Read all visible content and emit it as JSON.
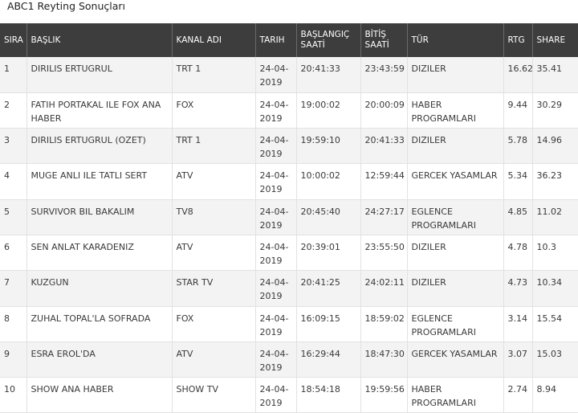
{
  "title": "ABC1 Reyting Sonuçları",
  "columns": [
    "SIRA",
    "BAŞLIK",
    "KANAL ADI",
    "TARIH",
    "BAŞLANGIÇ SAATİ",
    "BİTİŞ SAATİ",
    "TÜR",
    "RTG",
    "SHARE"
  ],
  "rows": [
    {
      "sira": "1",
      "baslik": "DIRILIS ERTUGRUL",
      "kanal": "TRT 1",
      "tarih": "24-04-2019",
      "baslangic": "20:41:33",
      "bitis": "23:43:59",
      "tur": "DIZILER",
      "rtg": "16.62",
      "share": "35.41"
    },
    {
      "sira": "2",
      "baslik": "FATIH PORTAKAL ILE FOX ANA HABER",
      "kanal": "FOX",
      "tarih": "24-04-2019",
      "baslangic": "19:00:02",
      "bitis": "20:00:09",
      "tur": "HABER PROGRAMLARI",
      "rtg": "9.44",
      "share": "30.29"
    },
    {
      "sira": "3",
      "baslik": "DIRILIS ERTUGRUL (OZET)",
      "kanal": "TRT 1",
      "tarih": "24-04-2019",
      "baslangic": "19:59:10",
      "bitis": "20:41:33",
      "tur": "DIZILER",
      "rtg": "5.78",
      "share": "14.96"
    },
    {
      "sira": "4",
      "baslik": "MUGE ANLI ILE TATLI SERT",
      "kanal": "ATV",
      "tarih": "24-04-2019",
      "baslangic": "10:00:02",
      "bitis": "12:59:44",
      "tur": "GERCEK YASAMLAR",
      "rtg": "5.34",
      "share": "36.23"
    },
    {
      "sira": "5",
      "baslik": "SURVIVOR BIL BAKALIM",
      "kanal": "TV8",
      "tarih": "24-04-2019",
      "baslangic": "20:45:40",
      "bitis": "24:27:17",
      "tur": "EGLENCE PROGRAMLARI",
      "rtg": "4.85",
      "share": "11.02"
    },
    {
      "sira": "6",
      "baslik": "SEN ANLAT KARADENIZ",
      "kanal": "ATV",
      "tarih": "24-04-2019",
      "baslangic": "20:39:01",
      "bitis": "23:55:50",
      "tur": "DIZILER",
      "rtg": "4.78",
      "share": "10.3"
    },
    {
      "sira": "7",
      "baslik": "KUZGUN",
      "kanal": "STAR TV",
      "tarih": "24-04-2019",
      "baslangic": "20:41:25",
      "bitis": "24:02:11",
      "tur": "DIZILER",
      "rtg": "4.73",
      "share": "10.34"
    },
    {
      "sira": "8",
      "baslik": "ZUHAL TOPAL'LA SOFRADA",
      "kanal": "FOX",
      "tarih": "24-04-2019",
      "baslangic": "16:09:15",
      "bitis": "18:59:02",
      "tur": "EGLENCE PROGRAMLARI",
      "rtg": "3.14",
      "share": "15.54"
    },
    {
      "sira": "9",
      "baslik": "ESRA EROL'DA",
      "kanal": "ATV",
      "tarih": "24-04-2019",
      "baslangic": "16:29:44",
      "bitis": "18:47:30",
      "tur": "GERCEK YASAMLAR",
      "rtg": "3.07",
      "share": "15.03"
    },
    {
      "sira": "10",
      "baslik": "SHOW ANA HABER",
      "kanal": "SHOW TV",
      "tarih": "24-04-2019",
      "baslangic": "18:54:18",
      "bitis": "19:59:56",
      "tur": "HABER PROGRAMLARI",
      "rtg": "2.74",
      "share": "8.94"
    }
  ]
}
